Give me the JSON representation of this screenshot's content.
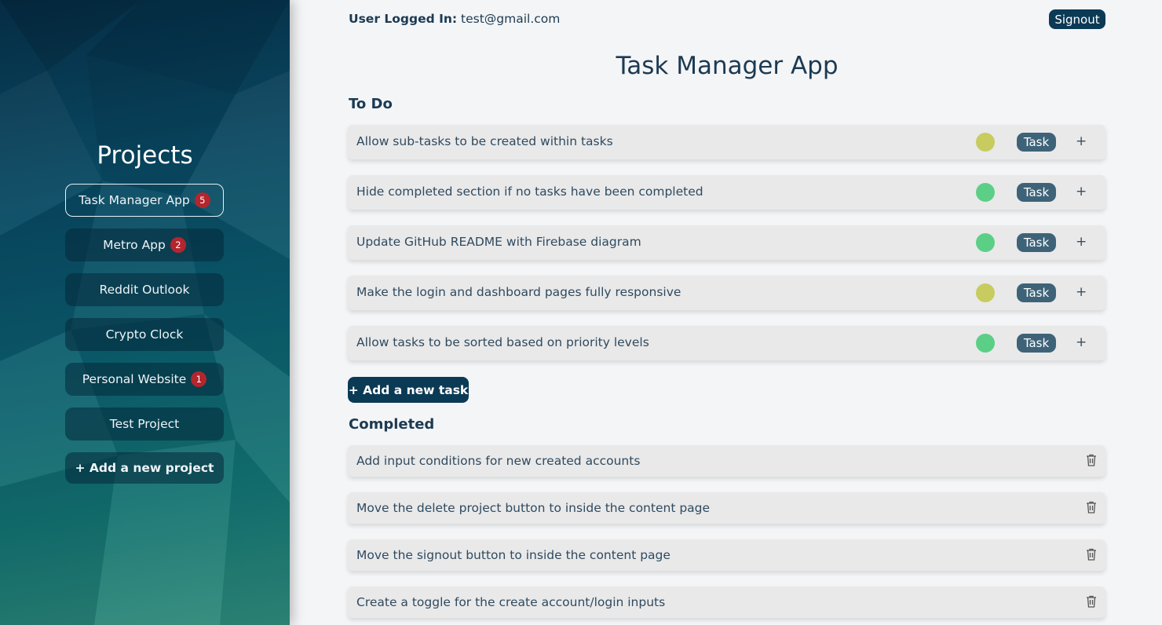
{
  "header": {
    "user_label": "User Logged In:",
    "user_email": "test@gmail.com",
    "signout_label": "Signout"
  },
  "sidebar": {
    "title": "Projects",
    "projects": [
      {
        "label": "Task Manager App",
        "badge": "5",
        "active": true
      },
      {
        "label": "Metro App",
        "badge": "2"
      },
      {
        "label": "Reddit Outlook"
      },
      {
        "label": "Crypto Clock"
      },
      {
        "label": "Personal Website",
        "badge": "1"
      },
      {
        "label": "Test Project"
      }
    ],
    "add_project_label": "+ Add a new project"
  },
  "main": {
    "title": "Task Manager App",
    "todo_heading": "To Do",
    "todo": [
      {
        "text": "Allow sub-tasks to be created within tasks",
        "priority_color": "#c8cc5e",
        "tag": "Task",
        "plus": "+"
      },
      {
        "text": "Hide completed section if no tasks have been completed",
        "priority_color": "#5ccf86",
        "tag": "Task",
        "plus": "+"
      },
      {
        "text": "Update GitHub README with Firebase diagram",
        "priority_color": "#5ccf86",
        "tag": "Task",
        "plus": "+"
      },
      {
        "text": "Make the login and dashboard pages fully responsive",
        "priority_color": "#c8cc5e",
        "tag": "Task",
        "plus": "+"
      },
      {
        "text": "Allow tasks to be sorted based on priority levels",
        "priority_color": "#5ccf86",
        "tag": "Task",
        "plus": "+"
      }
    ],
    "add_task_label": "+ Add a new task",
    "completed_heading": "Completed",
    "completed": [
      {
        "text": "Add input conditions for new created accounts"
      },
      {
        "text": "Move the delete project button to inside the content page"
      },
      {
        "text": "Move the signout button to inside the content page"
      },
      {
        "text": "Create a toggle for the create account/login inputs"
      }
    ]
  }
}
